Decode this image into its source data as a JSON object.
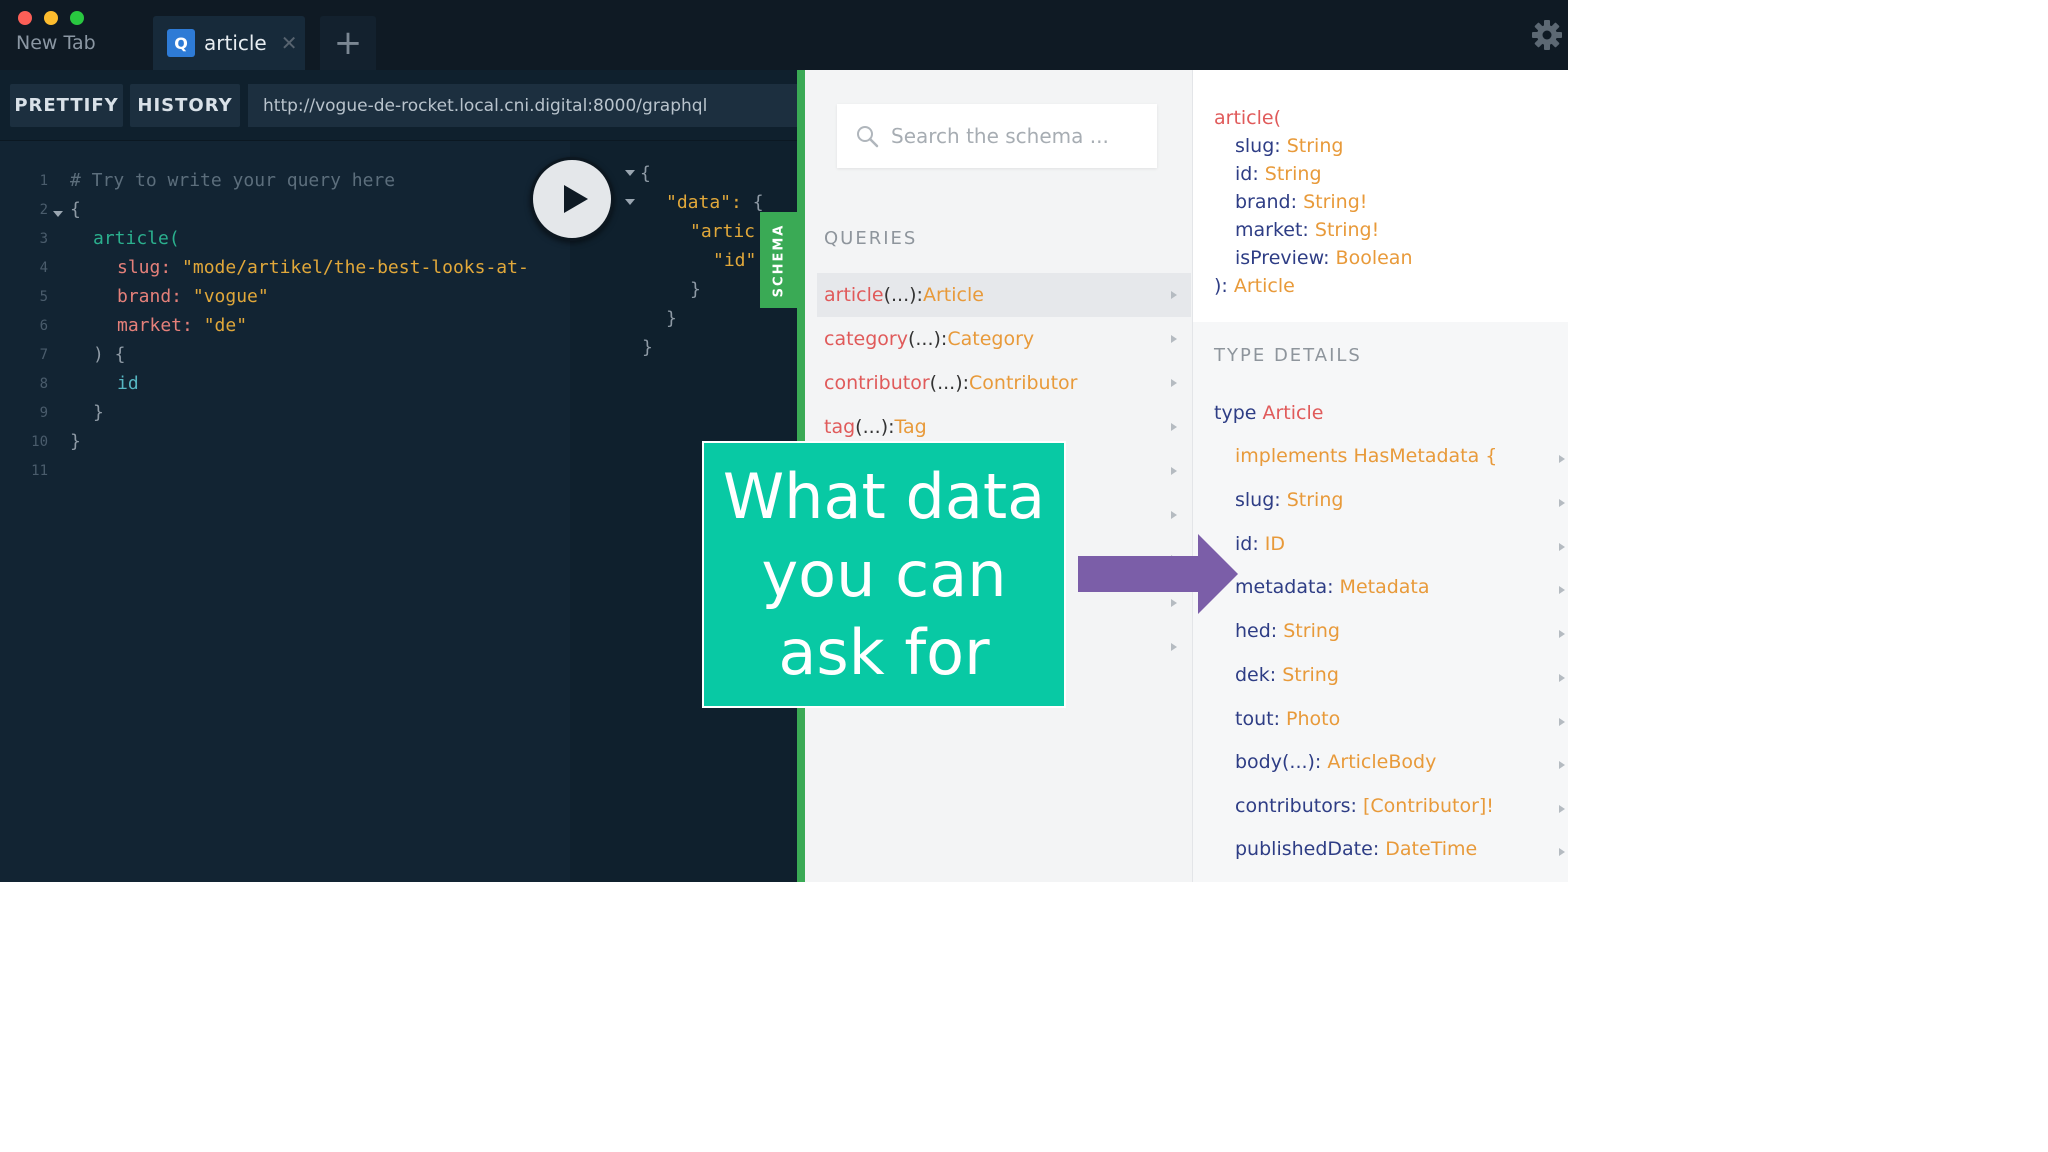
{
  "tabs": [
    {
      "label": "New Tab"
    },
    {
      "label": "article",
      "badge": "Q",
      "close": "✕"
    }
  ],
  "new_tab_symbol": "+",
  "toolbar": {
    "prettify": "PRETTIFY",
    "history": "HISTORY",
    "endpoint": "http://vogue-de-rocket.local.cni.digital:8000/graphql"
  },
  "editor": {
    "line_numbers": [
      "1",
      "2",
      "3",
      "4",
      "5",
      "6",
      "7",
      "8",
      "9",
      "10",
      "11"
    ],
    "comment": "# Try to write your query here",
    "open_brace": "{",
    "query_field": "article(",
    "arg_slug": "slug:",
    "arg_slug_value": "\"mode/artikel/the-best-looks-at-",
    "arg_brand": "brand:",
    "arg_brand_value": "\"vogue\"",
    "arg_market": "market:",
    "arg_market_value": "\"de\"",
    "close_args": ") {",
    "selection_id": "id",
    "close_selection": "}",
    "close_brace": "}"
  },
  "result": {
    "open_brace": "{",
    "data_key": "\"data\":",
    "data_brace": "{",
    "article_key": "\"artic",
    "id_key": "\"id\"",
    "close_1": "}",
    "close_2": "}",
    "close_3": "}"
  },
  "schema_tab": "SCHEMA",
  "docs": {
    "search_placeholder": "Search the schema ...",
    "queries_heading": "QUERIES",
    "queries": [
      {
        "name": "article",
        "args": "(...): ",
        "type": "Article"
      },
      {
        "name": "category",
        "args": "(...): ",
        "type": "Category"
      },
      {
        "name": "contributor",
        "args": "(...): ",
        "type": "Contributor"
      },
      {
        "name": "tag",
        "args": "(...): ",
        "type": "Tag"
      }
    ]
  },
  "details": {
    "signature_name": "article(",
    "signature_args": [
      {
        "name": "slug:",
        "type": "String"
      },
      {
        "name": "id:",
        "type": "String"
      },
      {
        "name": "brand:",
        "type": "String!"
      },
      {
        "name": "market:",
        "type": "String!"
      },
      {
        "name": "isPreview:",
        "type": "Boolean"
      }
    ],
    "signature_close": "):",
    "signature_return": "Article",
    "heading": "TYPE DETAILS",
    "type_keyword": "type",
    "type_name": "Article",
    "implements_keyword": "implements",
    "implements_name": "HasMetadata {",
    "fields": [
      {
        "name": "slug:",
        "type": "String"
      },
      {
        "name": "id:",
        "type": "ID"
      },
      {
        "name": "metadata:",
        "type": "Metadata"
      },
      {
        "name": "hed:",
        "type": "String"
      },
      {
        "name": "dek:",
        "type": "String"
      },
      {
        "name": "tout:",
        "type": "Photo"
      },
      {
        "name": "body(...):",
        "type": "ArticleBody"
      },
      {
        "name": "contributors:",
        "type": "[Contributor]!"
      },
      {
        "name": "publishedDate:",
        "type": "DateTime"
      }
    ]
  },
  "callout": {
    "text": "What data you can ask for"
  },
  "colors": {
    "accent_green": "#3aaa55",
    "callout_bg": "#08c9a4",
    "arrow": "#7b5ea8",
    "query_name": "#e05a5a",
    "type_name": "#e89a3a"
  },
  "icons": [
    "close-light",
    "minimize-light",
    "zoom-light",
    "gear-icon",
    "search-icon",
    "play-icon",
    "chevron-right-icon",
    "arrow-right-icon"
  ]
}
